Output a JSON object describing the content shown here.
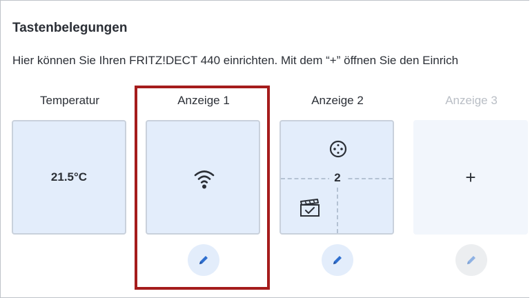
{
  "section": {
    "title": "Tastenbelegungen",
    "description": "Hier können Sie Ihren FRITZ!DECT 440 einrichten. Mit dem “+” öffnen Sie den Einrich"
  },
  "columns": [
    {
      "label": "Temperatur",
      "value": "21.5°C"
    },
    {
      "label": "Anzeige 1",
      "icon": "wifi-icon"
    },
    {
      "label": "Anzeige 2",
      "center_value": "2",
      "icons": [
        "power-socket-icon",
        "clapperboard-icon"
      ]
    },
    {
      "label": "Anzeige 3",
      "value": "+",
      "state": "disabled"
    }
  ],
  "edit_icon": "pencil-icon",
  "colors": {
    "tile_bg": "#e3edfb",
    "tile_border": "#c9d1dc",
    "accent_blue": "#2f6fcf",
    "highlight_red": "#a51c1c",
    "disabled_text": "#b9bec5"
  }
}
